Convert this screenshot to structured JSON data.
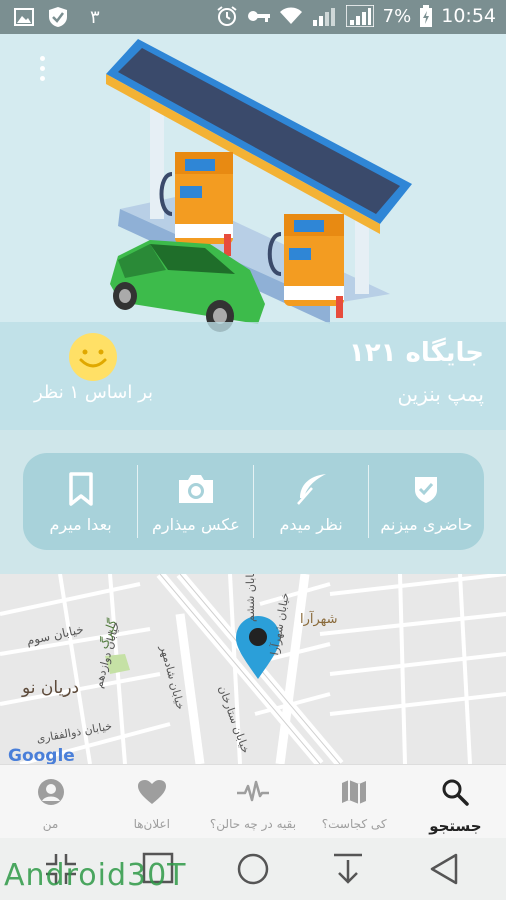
{
  "status_bar": {
    "notification_count": "٣",
    "battery_percent": "7%",
    "time": "10:54",
    "icons": [
      "image-icon",
      "shield-icon",
      "alarm-icon",
      "key-icon",
      "wifi-icon",
      "signal-icon",
      "signal-icon",
      "battery-charging-icon"
    ]
  },
  "station": {
    "name": "جایگاه ۱۲۱",
    "type": "پمپ بنزین",
    "rating_text": "بر اساس ۱ نظر",
    "rating_icon": "smiley-icon"
  },
  "actions": [
    {
      "label": "حاضری میزنم",
      "icon": "shield-check-icon"
    },
    {
      "label": "نظر میدم",
      "icon": "feather-icon"
    },
    {
      "label": "عکس میذارم",
      "icon": "camera-icon"
    },
    {
      "label": "بعدا میرم",
      "icon": "bookmark-icon"
    }
  ],
  "map": {
    "labels": {
      "street_a": "خیابان سوم",
      "street_b": "خیابان دوازدهم",
      "street_c": "خیابان ششم",
      "street_d": "خیابان شهرآرا",
      "street_e": "خیابان ستارخان",
      "street_f": "خیابان شادمهر",
      "street_g": "خیابان ذوالفقاری",
      "area_1": "شهرآرا",
      "area_2": "دریان نو",
      "park": "گلبرگ",
      "brand": "Google"
    },
    "colors": {
      "road": "#ffffff",
      "block": "#e8e8e8",
      "pin": "#2b9fd9",
      "park": "#c5e1a5"
    }
  },
  "bottom_nav": [
    {
      "label": "جستجو",
      "icon": "search-icon",
      "active": true
    },
    {
      "label": "کی کجاست؟",
      "icon": "map-icon",
      "active": false
    },
    {
      "label": "بقیه در چه حالن؟",
      "icon": "pulse-icon",
      "active": false
    },
    {
      "label": "اعلان‌ها",
      "icon": "heart-icon",
      "active": false
    },
    {
      "label": "من",
      "icon": "user-icon",
      "active": false
    }
  ],
  "watermark": "Android30T",
  "colors": {
    "status_bar": "#7b8f91",
    "hero_bg": "#d5ebf0",
    "band": "#bbdee6",
    "action_card": "#a8d2da",
    "nav_active": "#222222",
    "nav_inactive": "#9e9e9e"
  }
}
